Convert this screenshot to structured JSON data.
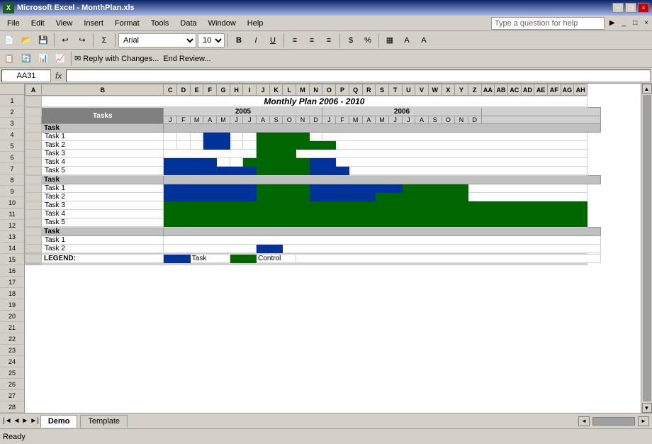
{
  "titleBar": {
    "title": "Microsoft Excel - MonthPlan.xls",
    "icon": "X",
    "winBtns": [
      "−",
      "□",
      "×"
    ]
  },
  "menuBar": {
    "items": [
      "File",
      "Edit",
      "View",
      "Insert",
      "Format",
      "Tools",
      "Data",
      "Window",
      "Help"
    ],
    "questionBox": "Type a question for help"
  },
  "toolbar": {
    "fontName": "Arial",
    "fontSize": "10"
  },
  "formulaBar": {
    "nameBox": "AA31",
    "fx": "fx"
  },
  "spreadsheet": {
    "title": "Monthly Plan 2006 - 2010",
    "columns": {
      "taskWidth": 120,
      "monthCols": [
        "J",
        "F",
        "M",
        "A",
        "M",
        "J",
        "J",
        "A",
        "S",
        "O",
        "N",
        "D",
        "J",
        "F",
        "M",
        "A",
        "M",
        "J",
        "J",
        "A",
        "S",
        "O",
        "N",
        "D"
      ]
    },
    "years": [
      {
        "label": "2005",
        "span": 12,
        "startCol": 2
      },
      {
        "label": "2006",
        "span": 12,
        "startCol": 14
      }
    ],
    "rows": [
      {
        "num": 1,
        "type": "empty"
      },
      {
        "num": 2,
        "type": "title",
        "label": "Monthly Plan 2006 - 2010"
      },
      {
        "num": 3,
        "type": "empty"
      },
      {
        "num": 4,
        "type": "colheaders"
      },
      {
        "num": 5,
        "type": "monthheaders"
      },
      {
        "num": 6,
        "type": "taskgroup",
        "label": "Task"
      },
      {
        "num": 7,
        "type": "task",
        "label": "Task 1",
        "cells": [
          0,
          0,
          0,
          1,
          1,
          0,
          0,
          2,
          2,
          2,
          2,
          0,
          0,
          0,
          0,
          0,
          0,
          0,
          0,
          0,
          0,
          0,
          0,
          0
        ]
      },
      {
        "num": 8,
        "type": "task",
        "label": "Task 2",
        "cells": [
          0,
          0,
          0,
          1,
          1,
          0,
          0,
          2,
          2,
          2,
          2,
          2,
          2,
          0,
          0,
          0,
          0,
          0,
          0,
          0,
          0,
          0,
          0,
          0
        ]
      },
      {
        "num": 9,
        "type": "task",
        "label": "Task 3",
        "cells": [
          0,
          0,
          0,
          0,
          0,
          0,
          0,
          0,
          2,
          2,
          2,
          0,
          0,
          0,
          0,
          0,
          0,
          0,
          0,
          0,
          0,
          0,
          0,
          0
        ]
      },
      {
        "num": 10,
        "type": "task",
        "label": "Task 4",
        "cells": [
          1,
          1,
          1,
          1,
          0,
          0,
          2,
          2,
          2,
          2,
          2,
          1,
          1,
          0,
          0,
          0,
          0,
          0,
          0,
          0,
          0,
          0,
          0,
          0
        ]
      },
      {
        "num": 11,
        "type": "task",
        "label": "Task 5",
        "cells": [
          1,
          1,
          1,
          1,
          1,
          1,
          1,
          2,
          2,
          2,
          2,
          1,
          1,
          1,
          0,
          0,
          0,
          0,
          0,
          0,
          0,
          0,
          0,
          0
        ]
      },
      {
        "num": 12,
        "type": "empty"
      },
      {
        "num": 13,
        "type": "taskgroup",
        "label": "Task"
      },
      {
        "num": 14,
        "type": "task",
        "label": "Task 1",
        "cells": [
          1,
          1,
          1,
          1,
          1,
          1,
          1,
          2,
          2,
          2,
          2,
          1,
          1,
          1,
          1,
          1,
          1,
          1,
          1,
          2,
          2,
          2,
          2,
          2
        ]
      },
      {
        "num": 15,
        "type": "task",
        "label": "Task 2",
        "cells": [
          1,
          1,
          1,
          1,
          1,
          1,
          1,
          2,
          2,
          2,
          2,
          1,
          1,
          1,
          1,
          1,
          1,
          2,
          2,
          2,
          2,
          2,
          2,
          2
        ]
      },
      {
        "num": 16,
        "type": "task",
        "label": "Task 3",
        "cells": [
          2,
          2,
          2,
          2,
          2,
          2,
          2,
          2,
          2,
          2,
          2,
          2,
          2,
          2,
          2,
          2,
          2,
          2,
          2,
          2,
          2,
          2,
          2,
          2
        ]
      },
      {
        "num": 17,
        "type": "task",
        "label": "Task 4",
        "cells": [
          2,
          2,
          2,
          2,
          2,
          2,
          2,
          2,
          2,
          2,
          2,
          2,
          2,
          2,
          2,
          2,
          2,
          2,
          2,
          2,
          2,
          2,
          2,
          2
        ]
      },
      {
        "num": 18,
        "type": "task",
        "label": "Task 5",
        "cells": [
          2,
          2,
          2,
          2,
          2,
          2,
          2,
          2,
          2,
          2,
          2,
          2,
          2,
          2,
          2,
          2,
          2,
          2,
          2,
          2,
          2,
          2,
          2,
          2
        ]
      },
      {
        "num": 19,
        "type": "empty"
      },
      {
        "num": 20,
        "type": "taskgroup",
        "label": "Task"
      },
      {
        "num": 21,
        "type": "task",
        "label": "Task 1",
        "cells": [
          0,
          0,
          0,
          0,
          0,
          0,
          0,
          0,
          0,
          0,
          0,
          0,
          0,
          0,
          0,
          0,
          0,
          0,
          0,
          0,
          0,
          0,
          0,
          0
        ]
      },
      {
        "num": 22,
        "type": "task",
        "label": "Task 2",
        "cells": [
          0,
          0,
          0,
          0,
          0,
          0,
          0,
          0,
          1,
          1,
          0,
          0,
          0,
          0,
          0,
          0,
          0,
          0,
          0,
          0,
          0,
          0,
          0,
          0
        ]
      },
      {
        "num": 23,
        "type": "empty"
      },
      {
        "num": 24,
        "type": "empty"
      },
      {
        "num": 25,
        "type": "legend"
      },
      {
        "num": 26,
        "type": "empty"
      },
      {
        "num": 27,
        "type": "empty"
      },
      {
        "num": 28,
        "type": "empty"
      }
    ]
  },
  "legend": {
    "taskLabel": "Task",
    "controlLabel": "Control",
    "taskColor": "#003399",
    "controlColor": "#006600"
  },
  "sheets": [
    "Demo",
    "Template"
  ],
  "activeSheet": "Demo",
  "status": "Ready"
}
